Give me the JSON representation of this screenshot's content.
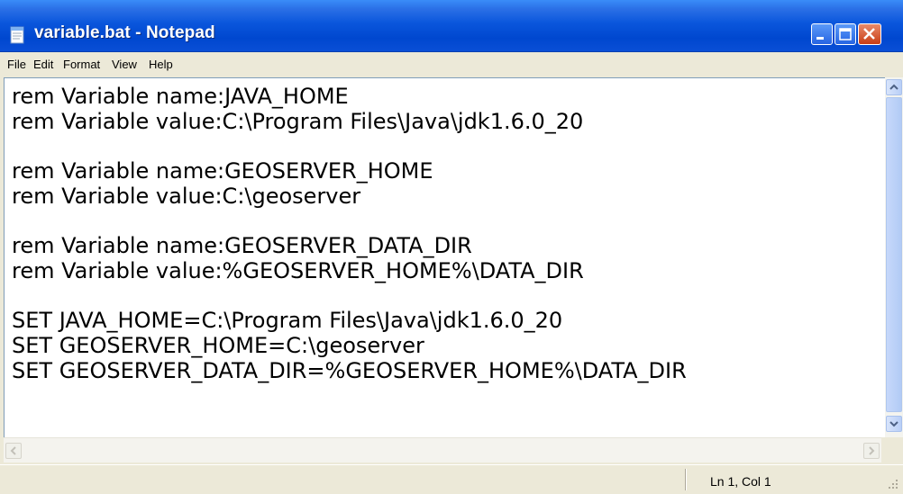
{
  "window": {
    "title": "variable.bat - Notepad",
    "title_bar_color": "#0a56dc",
    "close_button_color": "#c93d15"
  },
  "icons": {
    "app": "notepad-icon",
    "minimize": "minimize-icon",
    "maximize": "maximize-icon",
    "close": "close-icon",
    "scroll_up": "arrow-up-icon",
    "scroll_down": "arrow-down-icon",
    "scroll_left": "arrow-left-icon",
    "scroll_right": "arrow-right-icon",
    "size_grip": "size-grip-icon"
  },
  "menu": {
    "items": [
      {
        "label": "File"
      },
      {
        "label": "Edit"
      },
      {
        "label": "Format"
      },
      {
        "label": "View"
      },
      {
        "label": "Help"
      }
    ]
  },
  "document": {
    "lines": [
      "rem Variable name:JAVA_HOME",
      "rem Variable value:C:\\Program Files\\Java\\jdk1.6.0_20",
      "",
      "rem Variable name:GEOSERVER_HOME",
      "rem Variable value:C:\\geoserver",
      "",
      "rem Variable name:GEOSERVER_DATA_DIR",
      "rem Variable value:%GEOSERVER_HOME%\\DATA_DIR",
      "",
      "SET JAVA_HOME=C:\\Program Files\\Java\\jdk1.6.0_20",
      "SET GEOSERVER_HOME=C:\\geoserver",
      "SET GEOSERVER_DATA_DIR=%GEOSERVER_HOME%\\DATA_DIR"
    ]
  },
  "status": {
    "position": "Ln 1, Col 1"
  }
}
